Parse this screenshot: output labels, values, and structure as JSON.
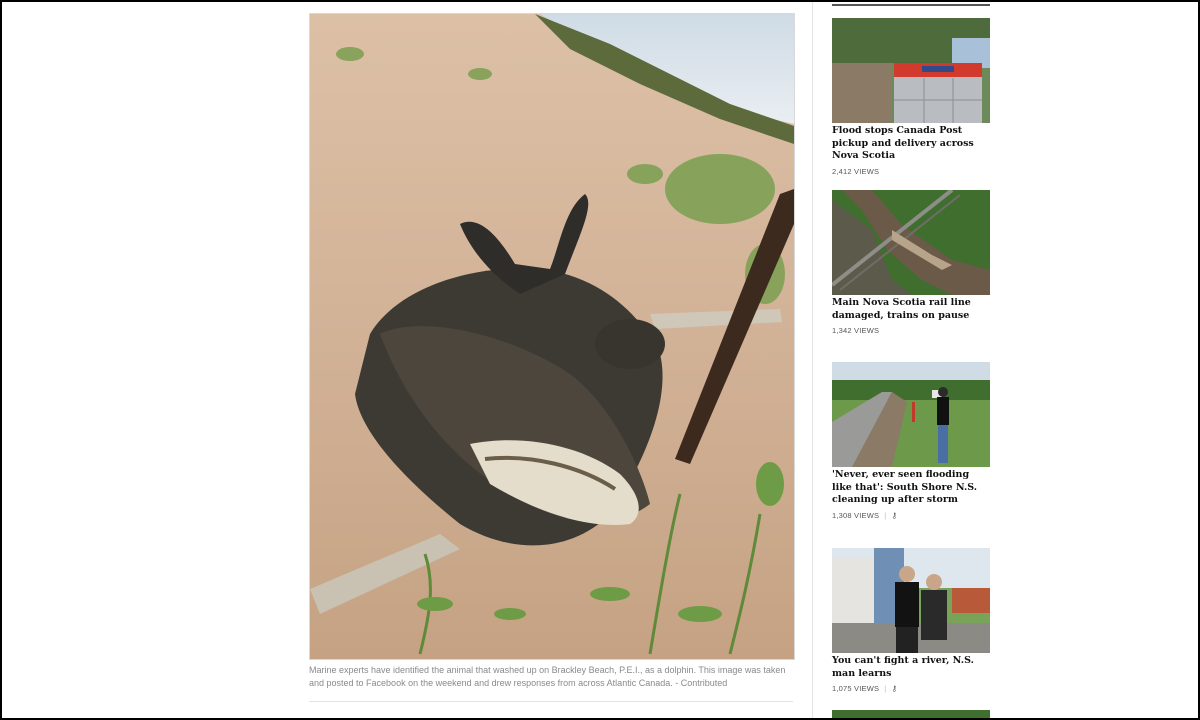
{
  "article": {
    "image_alt": "Dolphin carcass on Brackley Beach sand",
    "caption": "Marine experts have identified the animal that washed up on Brackley Beach, P.E.I., as a dolphin. This image was taken and posted to Facebook on the weekend and drew responses from across Atlantic Canada. - Contributed"
  },
  "sidebar": {
    "stories": [
      {
        "title": "Flood stops Canada Post pickup and delivery across Nova Scotia",
        "views": "2,412 VIEWS",
        "key": false
      },
      {
        "title": "Main Nova Scotia rail line damaged, trains on pause",
        "views": "1,342 VIEWS",
        "key": false
      },
      {
        "title": "'Never, ever seen flooding like that': South Shore N.S. cleaning up after storm",
        "views": "1,308 VIEWS",
        "key": true
      },
      {
        "title": "You can't fight a river, N.S. man learns",
        "views": "1,075 VIEWS",
        "key": true
      }
    ]
  },
  "colors": {
    "frame": "#000000",
    "text": "#111111",
    "caption": "#8a8a8a"
  }
}
